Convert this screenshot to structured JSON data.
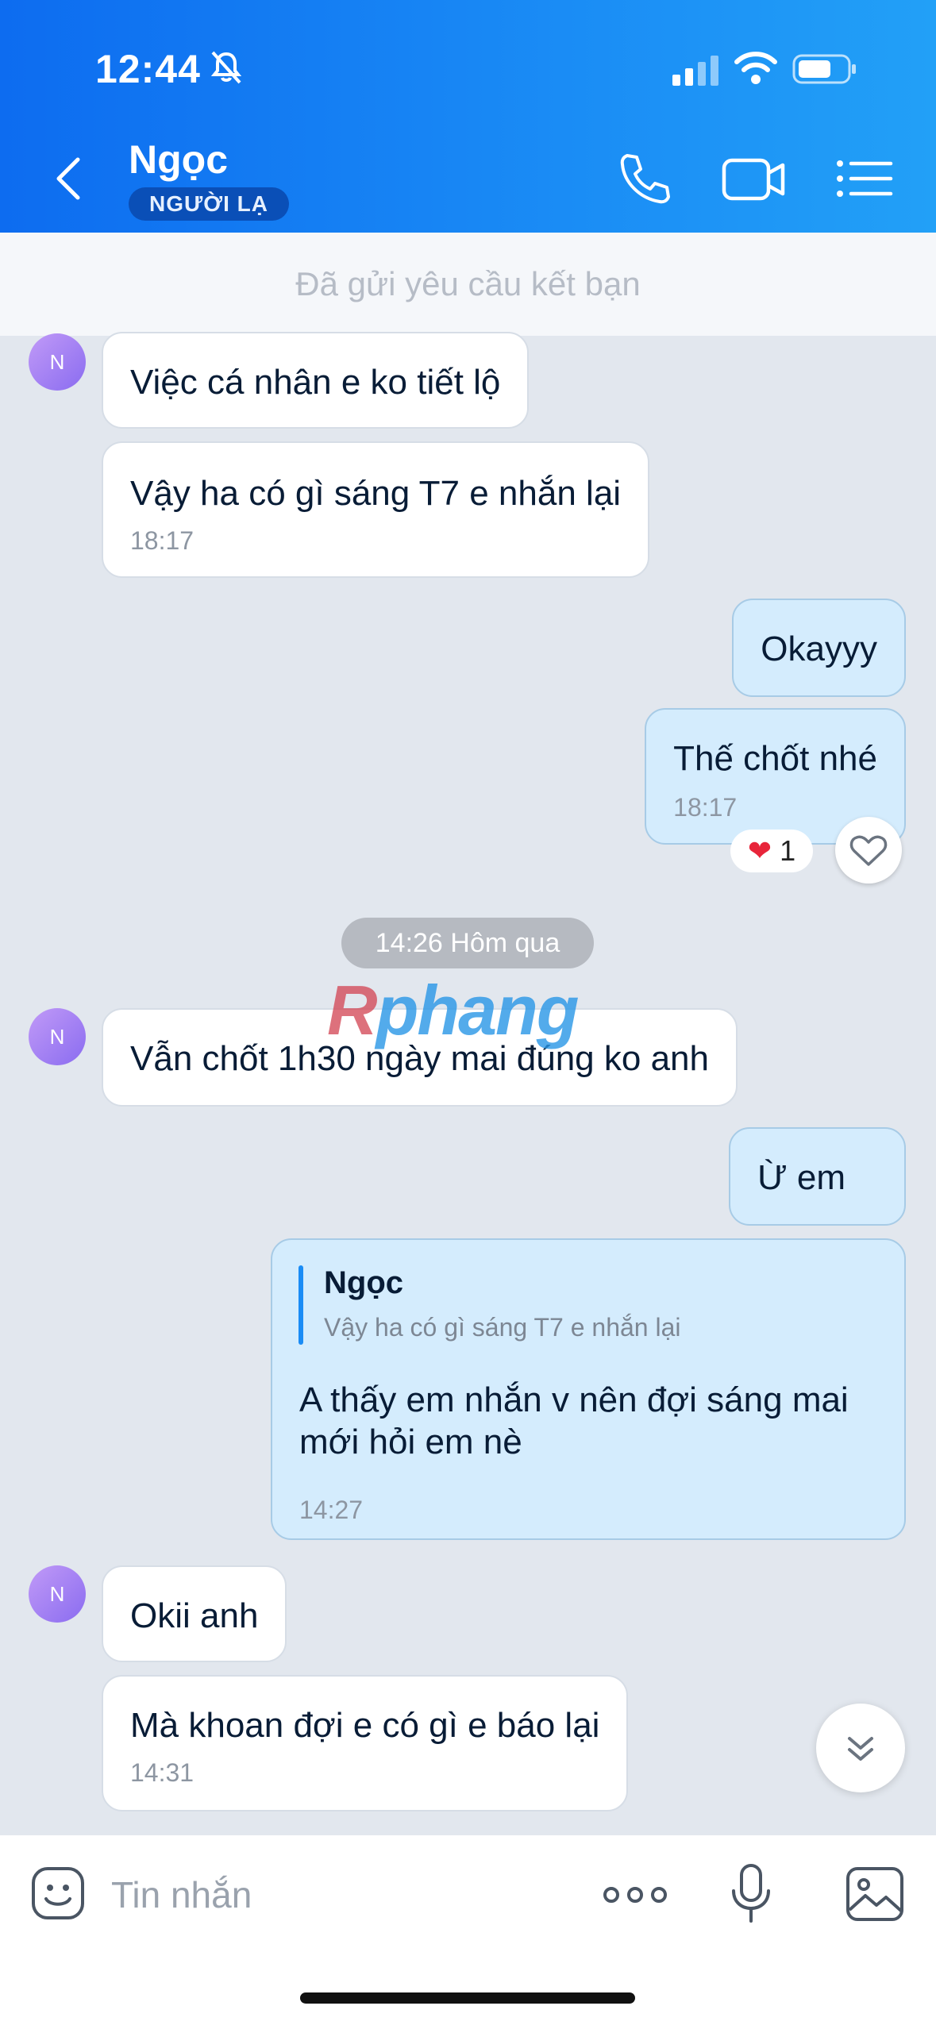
{
  "status_bar": {
    "time": "12:44"
  },
  "header": {
    "contact_name": "Ngọc",
    "badge": "NGƯỜI LẠ"
  },
  "friend_request": "Đã gửi yêu cầu kết bạn",
  "avatar_initial": "N",
  "messages": [
    {
      "side": "in",
      "text": "Việc cá nhân e ko tiết lộ"
    },
    {
      "side": "in",
      "text": "Vậy ha có gì sáng T7 e nhắn lại",
      "time": "18:17"
    },
    {
      "side": "out",
      "text": "Okayyy"
    },
    {
      "side": "out",
      "text": "Thế chốt nhé",
      "time": "18:17",
      "reaction_count": "1"
    },
    {
      "side": "in",
      "text": "Vẫn chốt 1h30 ngày mai đúng ko anh"
    },
    {
      "side": "out",
      "text": "Ừ em"
    },
    {
      "side": "out",
      "quote_name": "Ngọc",
      "quote_text": "Vậy ha có gì sáng T7 e nhắn lại",
      "text": "A thấy em nhắn v nên đợi sáng mai mới hỏi em nè",
      "time": "14:27"
    },
    {
      "side": "in",
      "text": "Okii anh"
    },
    {
      "side": "in",
      "text": "Mà khoan đợi e có gì e báo lại",
      "time": "14:31"
    }
  ],
  "date_divider": "14:26 Hôm qua",
  "watermark": {
    "part1": "R",
    "part2": "phang"
  },
  "composer": {
    "placeholder": "Tin nhắn"
  },
  "colors": {
    "header": "#0d6cf0",
    "outgoing_bubble": "#d4ecfd",
    "incoming_bubble": "#ffffff",
    "background": "#e2e7ee"
  }
}
